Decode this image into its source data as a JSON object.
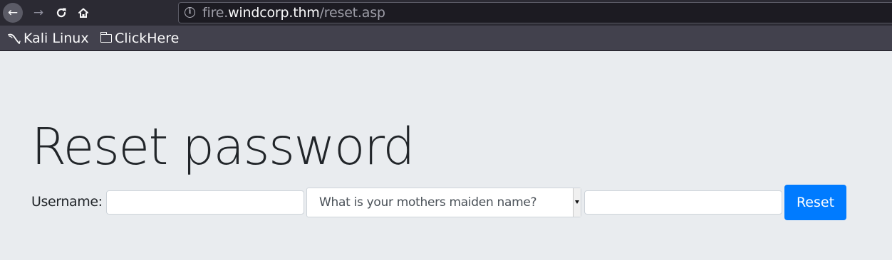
{
  "browser": {
    "nav": {
      "back_icon": "arrow-left-icon",
      "forward_icon": "arrow-right-icon",
      "reload_icon": "reload-icon",
      "home_icon": "home-icon"
    },
    "url": {
      "subdomain": "fire.",
      "host": "windcorp.thm",
      "path": "/reset.asp"
    },
    "bookmarks": [
      {
        "label": "Kali Linux",
        "icon": "kali-dragon-icon"
      },
      {
        "label": "ClickHere",
        "icon": "folder-icon"
      }
    ]
  },
  "page": {
    "title": "Reset password",
    "form": {
      "username_label": "Username:",
      "username_value": "",
      "question_selected": "What is your mothers maiden name?",
      "answer_value": "",
      "submit_label": "Reset"
    }
  },
  "colors": {
    "page_background": "#e9ecef",
    "button_primary": "#007bff",
    "toolbar_background": "#2b2a33",
    "bookmarks_background": "#42414d"
  }
}
